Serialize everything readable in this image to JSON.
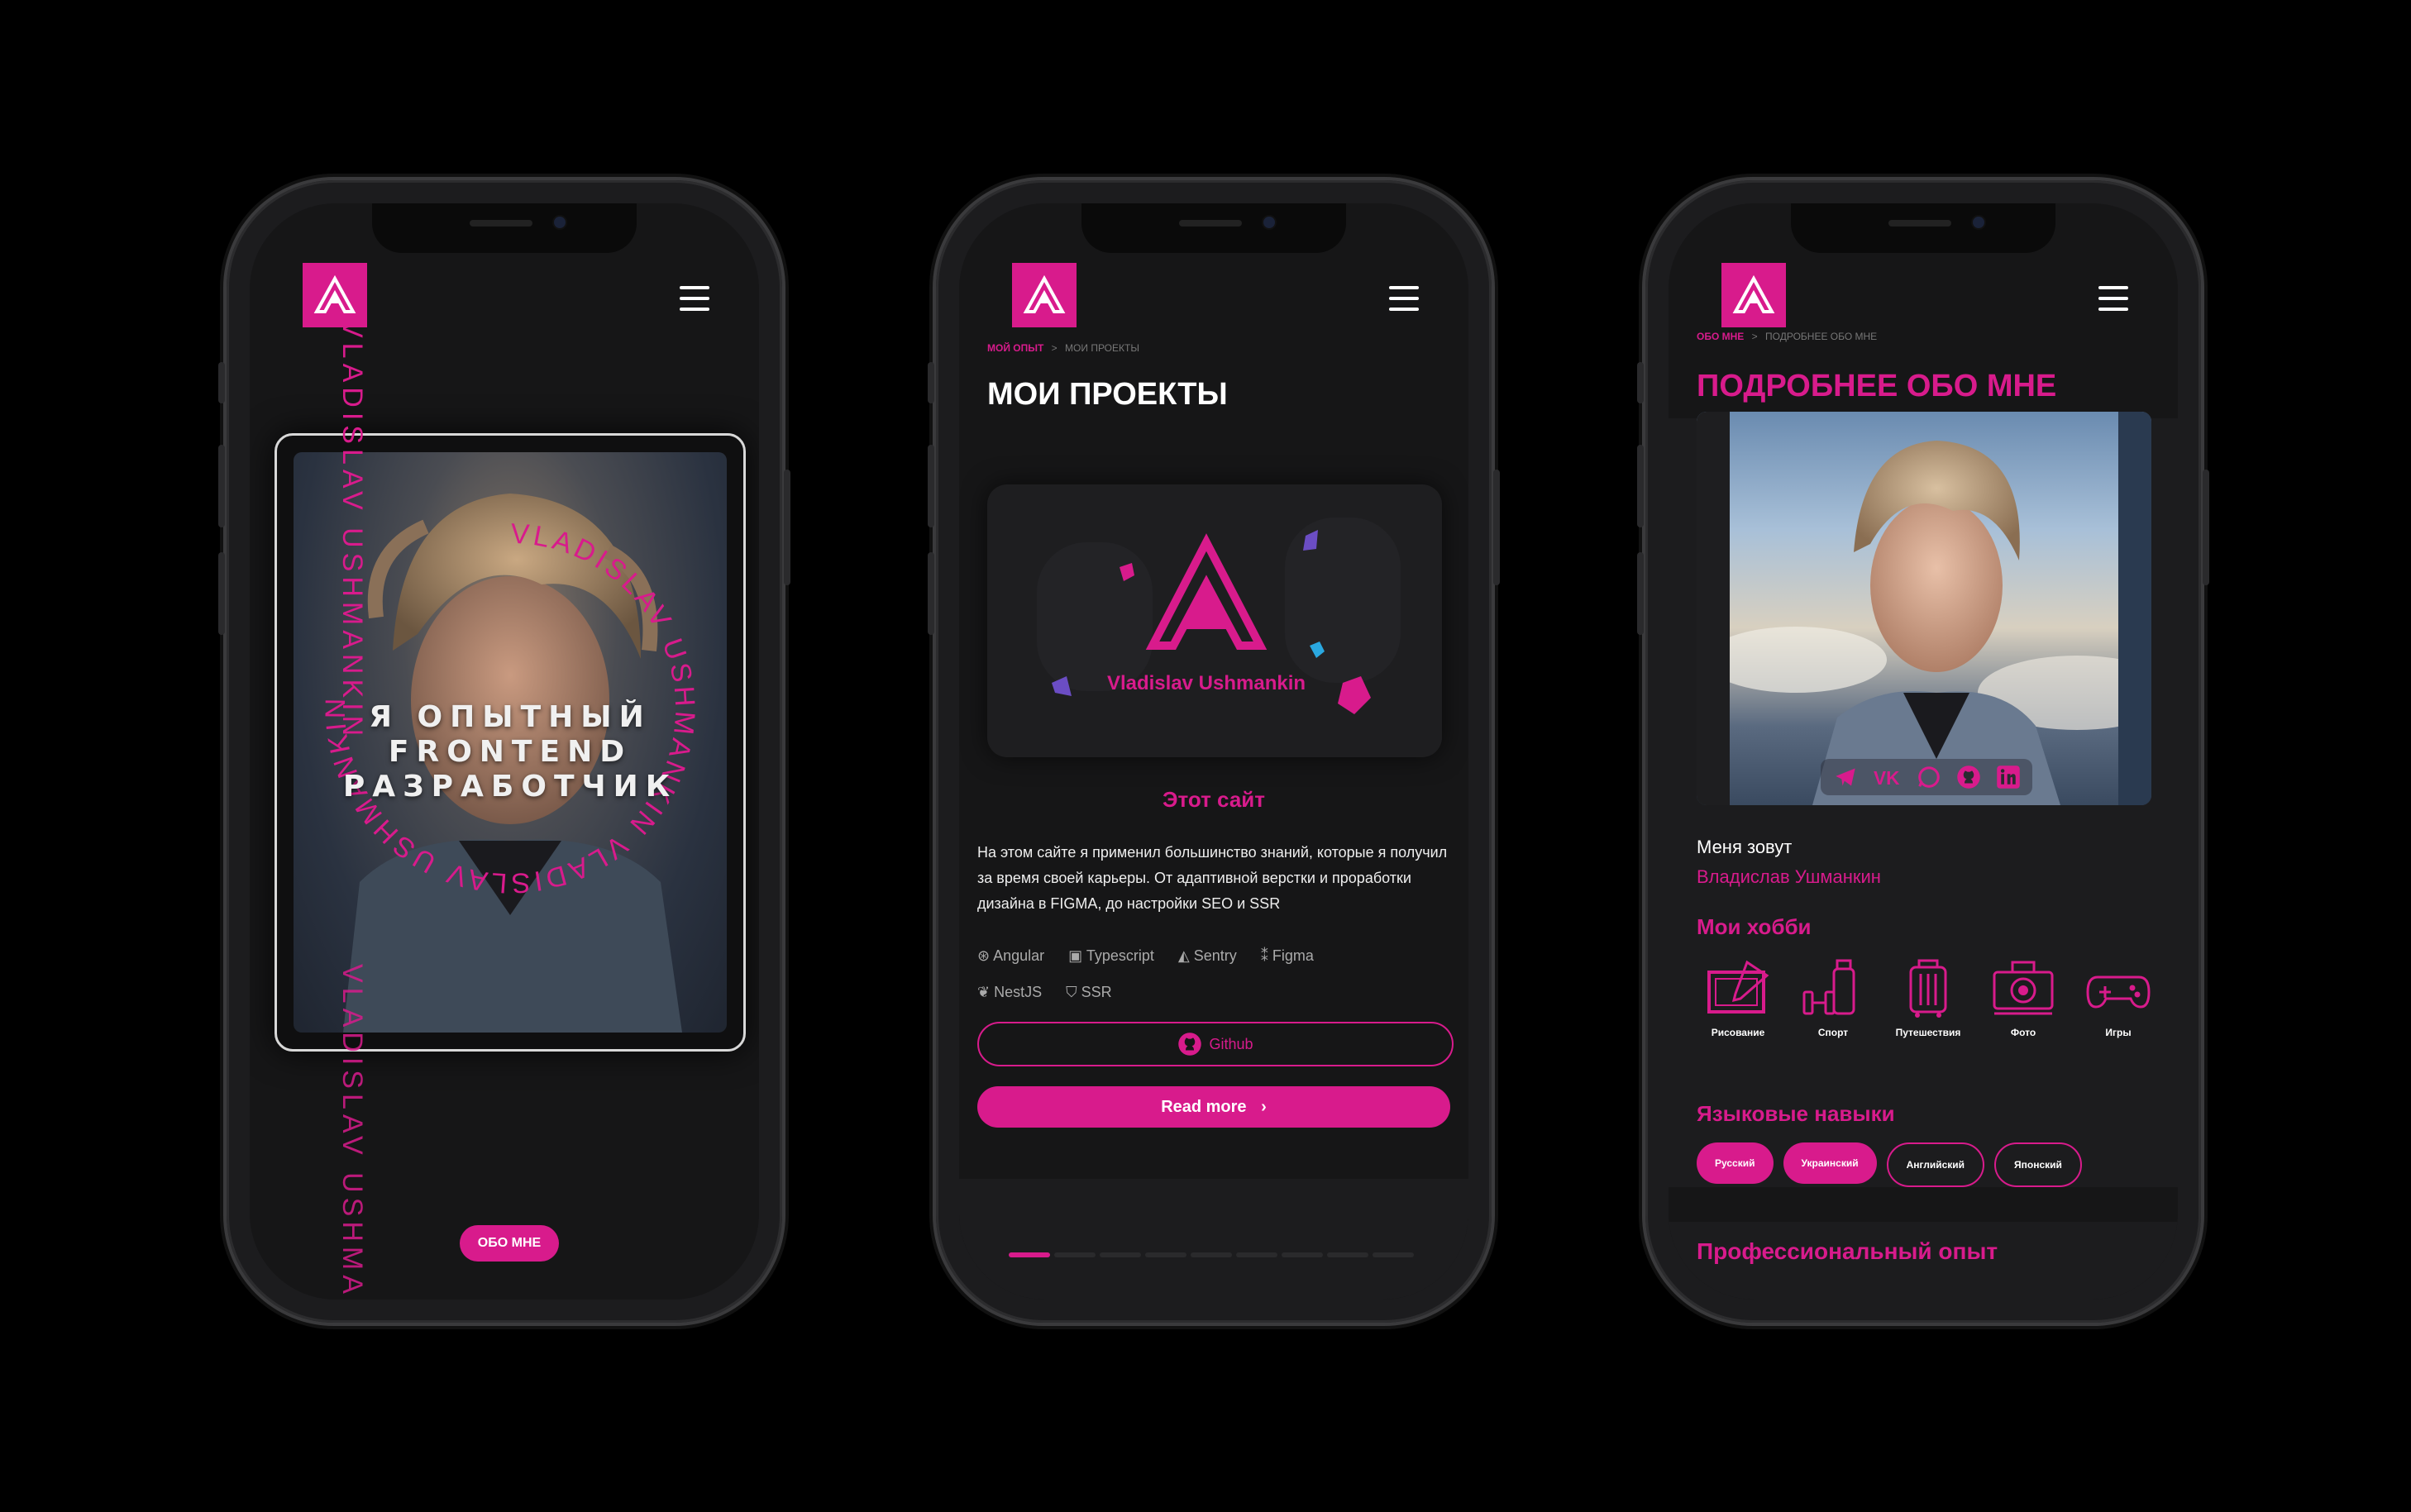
{
  "colors": {
    "accent": "#d81b8c",
    "background": "#000000",
    "screen": "#161617"
  },
  "phone1": {
    "vertical_name": "VLADISLAV USHMANKIN",
    "vertical_name_bottom": "VLADISLAV USHMANK",
    "circle_text": "VLADISLAV USHMANKIN VLADISLAV USHMANKIN",
    "hero_title_lines": [
      "Я ОПЫТНЫЙ",
      "FRONTEND",
      "РАЗРАБОТЧИК"
    ],
    "about_button": "ОБО МНЕ"
  },
  "phone2": {
    "breadcrumb": {
      "parent": "МОЙ ОПЫТ",
      "separator": ">",
      "current": "МОИ ПРОЕКТЫ"
    },
    "title": "МОИ ПРОЕКТЫ",
    "card_brand": "Vladislav Ushmankin",
    "project_name": "Этот сайт",
    "project_description": "На этом сайте я применил большинство знаний, которые я получил за время своей карьеры. От адаптивной верстки и проработки дизайна в FIGMA, до настройки SEO и SSR",
    "tags": [
      "Angular",
      "Typescript",
      "Sentry",
      "Figma",
      "NestJS",
      "SSR"
    ],
    "github_button": "Github",
    "readmore_button": "Read more"
  },
  "phone3": {
    "breadcrumb": {
      "parent": "ОБО МНЕ",
      "separator": ">",
      "current": "ПОДРОБНЕЕ ОБО МНЕ"
    },
    "title": "ПОДРОБНЕЕ ОБО МНЕ",
    "name_label": "Меня зовут",
    "name_value": "Владислав Ушманкин",
    "hobbies_title": "Мои хобби",
    "hobbies": [
      "Рисование",
      "Спорт",
      "Путешествия",
      "Фото",
      "Игры"
    ],
    "languages_title": "Языковые навыки",
    "languages": [
      "Русский",
      "Украинский",
      "Английский",
      "Японский"
    ],
    "experience_title": "Профессиональный опыт"
  }
}
